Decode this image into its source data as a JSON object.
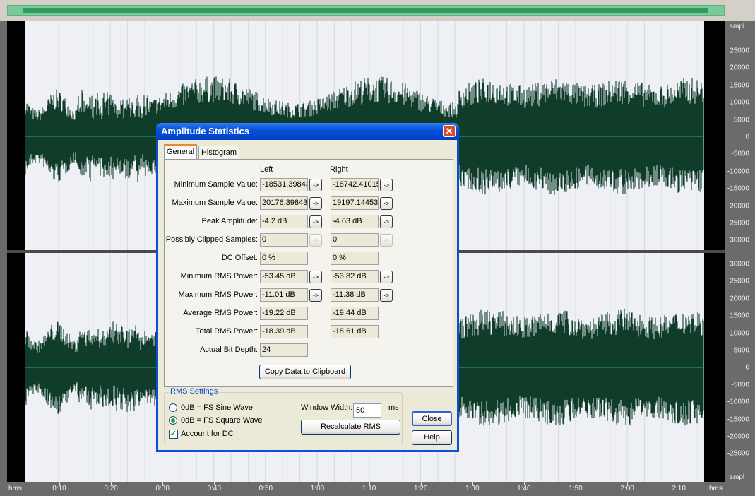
{
  "colors": {
    "waveform": "#0f3d2a",
    "background": "#eef0f6",
    "accent": "#0a4fd4"
  },
  "vertical_scale": {
    "unit": "smpl",
    "top_channel": [
      "25000",
      "20000",
      "15000",
      "10000",
      "5000",
      "0",
      "-5000",
      "-10000",
      "-15000",
      "-20000",
      "-25000",
      "-30000"
    ],
    "bottom_channel": [
      "30000",
      "25000",
      "20000",
      "15000",
      "10000",
      "5000",
      "0",
      "-5000",
      "-10000",
      "-15000",
      "-20000",
      "-25000"
    ]
  },
  "timeline": {
    "unit": "hms",
    "labels": [
      "0:10",
      "0:20",
      "0:30",
      "0:40",
      "0:50",
      "1:00",
      "1:10",
      "1:20",
      "1:30",
      "1:40",
      "1:50",
      "2:00",
      "2:10"
    ]
  },
  "dialog": {
    "title": "Amplitude Statistics",
    "close_glyph": "✕",
    "tabs": [
      {
        "label": "General"
      },
      {
        "label": "Histogram"
      }
    ],
    "columns": {
      "left": "Left",
      "right": "Right"
    },
    "arrow_glyph": "->",
    "rows": [
      {
        "label": "Minimum Sample Value:",
        "left": "-18531.39843",
        "right": "-18742.41015"
      },
      {
        "label": "Maximum Sample Value:",
        "left": "20176.39843",
        "right": "19197.14453"
      },
      {
        "label": "Peak Amplitude:",
        "left": "-4.2 dB",
        "right": "-4.63 dB"
      },
      {
        "label": "Possibly Clipped Samples:",
        "left": "0",
        "right": "0"
      },
      {
        "label": "DC Offset:",
        "left": "0 %",
        "right": "0 %"
      },
      {
        "label": "Minimum RMS Power:",
        "left": "-53.45 dB",
        "right": "-53.82 dB"
      },
      {
        "label": "Maximum RMS Power:",
        "left": "-11.01 dB",
        "right": "-11.38 dB"
      },
      {
        "label": "Average RMS Power:",
        "left": "-19.22 dB",
        "right": "-19.44 dB"
      },
      {
        "label": "Total RMS Power:",
        "left": "-18.39 dB",
        "right": "-18.61 dB"
      },
      {
        "label": "Actual Bit Depth:",
        "left": "24"
      }
    ],
    "copy_button": "Copy Data to Clipboard",
    "rms_settings": {
      "legend": "RMS Settings",
      "option_sine": "0dB = FS Sine Wave",
      "option_square": "0dB = FS Square Wave",
      "selected": "0dB = FS Square Wave",
      "account_dc": "Account for DC",
      "account_dc_checked": true,
      "window_width_label": "Window Width:",
      "window_width_value": "50",
      "window_width_unit": "ms",
      "recalculate_button": "Recalculate RMS"
    },
    "close_button": "Close",
    "help_button": "Help"
  }
}
